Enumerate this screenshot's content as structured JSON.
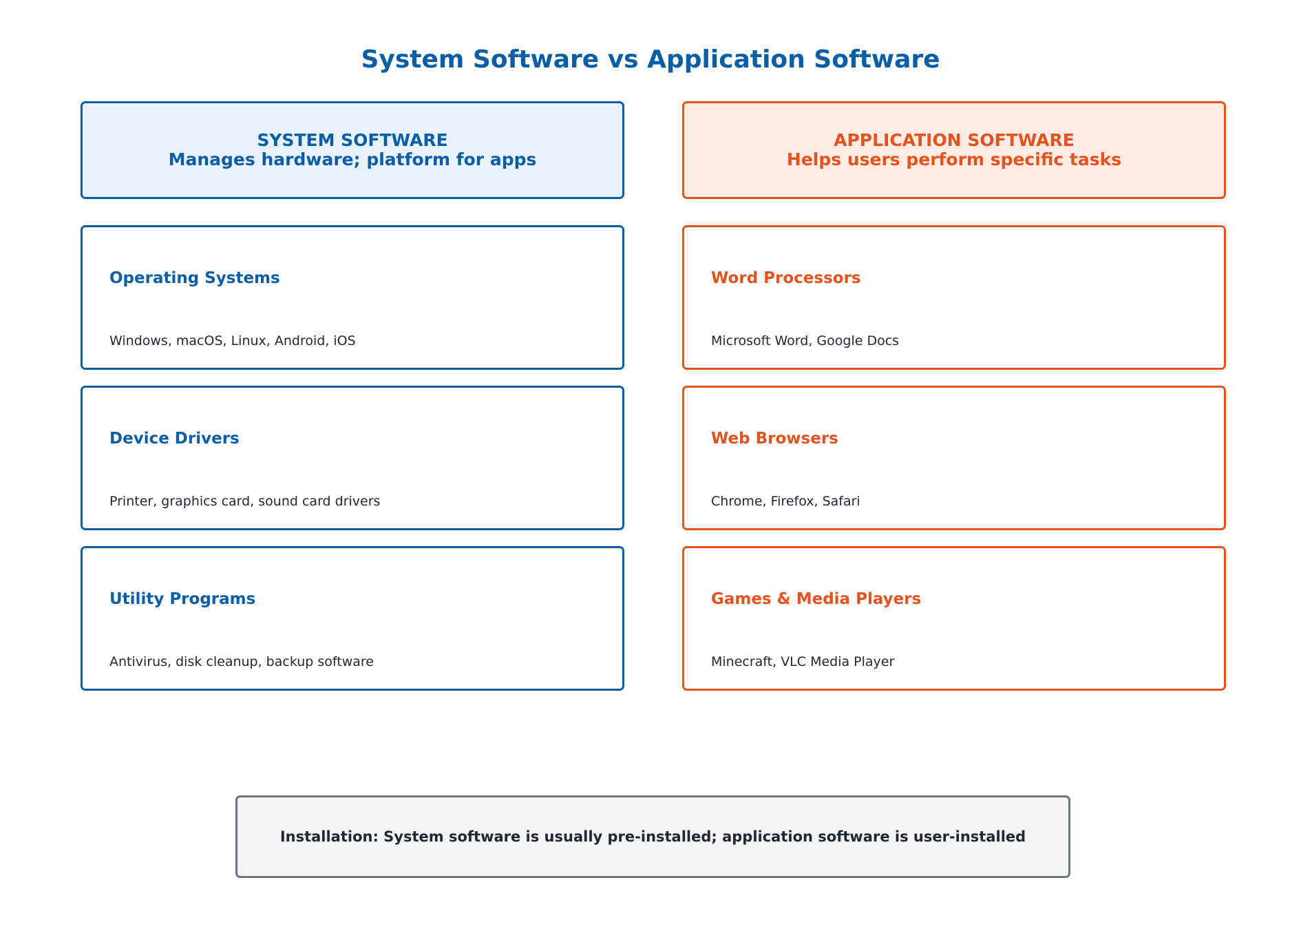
{
  "title": "System Software vs Application Software",
  "colors": {
    "system": "#0a5ea6",
    "system_fill": "#e9f2fb",
    "application": "#e3531d",
    "application_fill": "#fdece5",
    "text_dark": "#1f2733",
    "footer_border": "#6b7280",
    "footer_fill": "#f3f4f6"
  },
  "system": {
    "header_line1": "SYSTEM SOFTWARE",
    "header_line2": "Manages hardware; platform for apps",
    "items": [
      {
        "title": "Operating Systems",
        "desc": "Windows, macOS, Linux, Android, iOS"
      },
      {
        "title": "Device Drivers",
        "desc": "Printer, graphics card, sound card drivers"
      },
      {
        "title": "Utility Programs",
        "desc": "Antivirus, disk cleanup, backup software"
      }
    ]
  },
  "application": {
    "header_line1": "APPLICATION SOFTWARE",
    "header_line2": "Helps users perform specific tasks",
    "items": [
      {
        "title": "Word Processors",
        "desc": "Microsoft Word, Google Docs"
      },
      {
        "title": "Web Browsers",
        "desc": "Chrome, Firefox, Safari"
      },
      {
        "title": "Games & Media Players",
        "desc": "Minecraft, VLC Media Player"
      }
    ]
  },
  "footer": "Installation: System software is usually pre-installed; application software is user-installed"
}
